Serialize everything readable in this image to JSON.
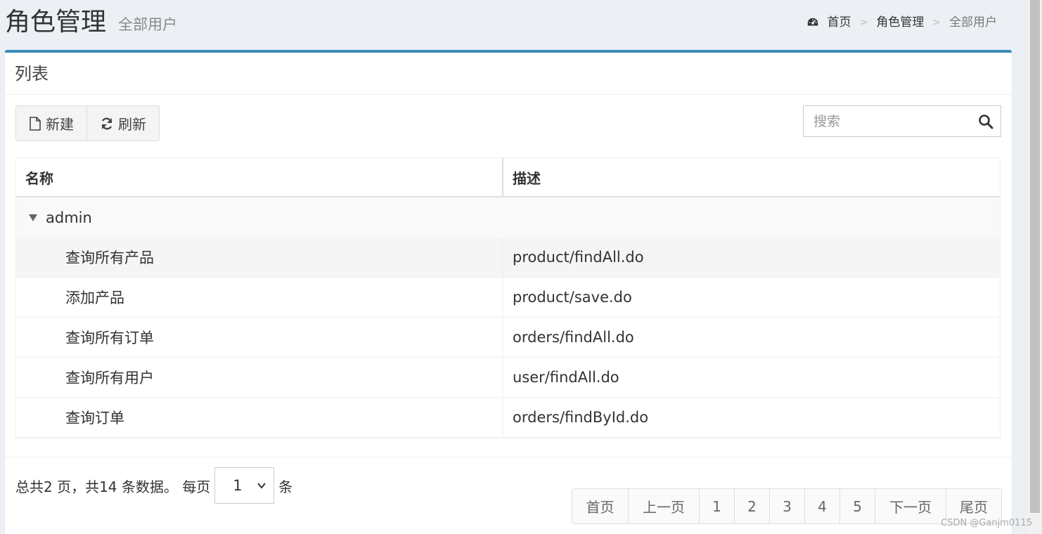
{
  "header": {
    "title": "角色管理",
    "subtitle": "全部用户",
    "breadcrumb": [
      "首页",
      "角色管理",
      "全部用户"
    ],
    "breadcrumb_sep": ">"
  },
  "box": {
    "title": "列表"
  },
  "toolbar": {
    "new_label": "新建",
    "refresh_label": "刷新"
  },
  "search": {
    "placeholder": "搜索"
  },
  "table": {
    "columns": [
      "名称",
      "描述"
    ],
    "group_label": "admin",
    "rows": [
      {
        "name": "查询所有产品",
        "desc": "product/findAll.do"
      },
      {
        "name": "添加产品",
        "desc": "product/save.do"
      },
      {
        "name": "查询所有订单",
        "desc": "orders/findAll.do"
      },
      {
        "name": "查询所有用户",
        "desc": "user/findAll.do"
      },
      {
        "name": "查询订单",
        "desc": "orders/findById.do"
      }
    ]
  },
  "pager_info": {
    "summary": "总共2 页，共14 条数据。 每页",
    "page_size": "1",
    "unit": "条"
  },
  "pagination": [
    "首页",
    "上一页",
    "1",
    "2",
    "3",
    "4",
    "5",
    "下一页",
    "尾页"
  ],
  "watermark": "CSDN @Ganjm0115",
  "colors": {
    "accent": "#3c8dbc",
    "background": "#ecf0f5"
  }
}
